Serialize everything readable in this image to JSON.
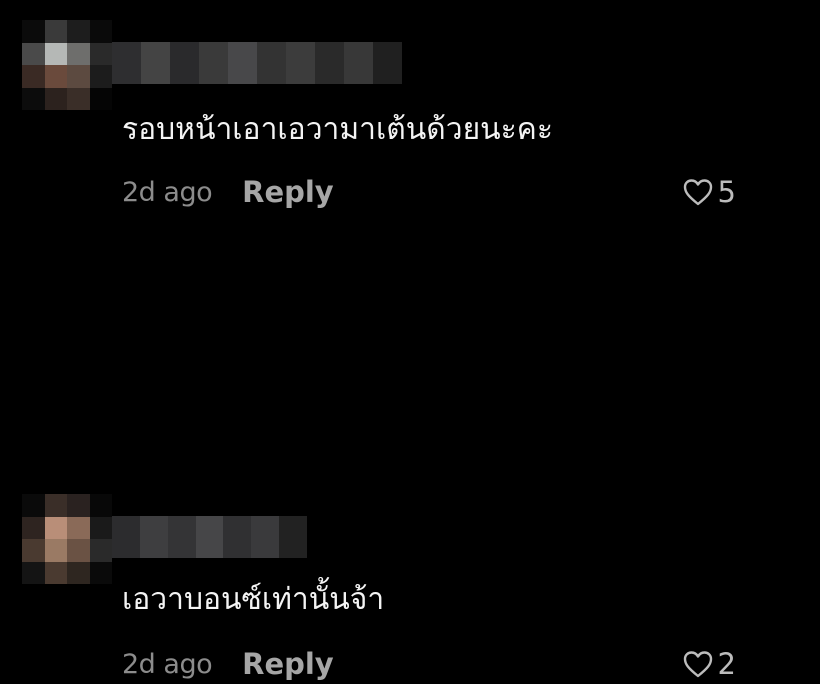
{
  "comments": [
    {
      "text": "รอบหน้าเอาเอวามาเต้นด้วยนะคะ",
      "time": "2d ago",
      "reply_label": "Reply",
      "likes": "5",
      "icon": "heart-icon"
    },
    {
      "text": "เอวาบอนซ์เท่านั้นจ้า",
      "time": "2d ago",
      "reply_label": "Reply",
      "likes": "2",
      "icon": "heart-icon"
    }
  ]
}
